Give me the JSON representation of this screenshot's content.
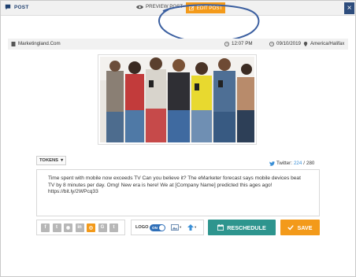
{
  "header": {
    "title": "POST",
    "tabs": [
      {
        "label": "PREVIEW POST",
        "icon": "eye-icon",
        "active": false
      },
      {
        "label": "EDIT POST",
        "icon": "edit-icon",
        "active": true
      }
    ],
    "close_label": "×"
  },
  "info": {
    "account": "Marketingland.Com",
    "time": "12:07 PM",
    "date": "09/10/2019",
    "timezone": "America/Halifax"
  },
  "tokens": {
    "label": "TOKENS",
    "arrow": "▾"
  },
  "twitter": {
    "label": "Twitter:",
    "count": "224",
    "separator": "/",
    "limit": "280"
  },
  "message": "Time spent with mobile now exceeds TV  Can you believe it? The eMarketer forecast says mobile devices beat TV by 8 minutes per day. Omg! New era is here! We at  [Company Name] predicted this ages ago!  https://bit.ly/2WPcq33",
  "social": [
    {
      "label": "f",
      "icon": "facebook-icon",
      "active": false
    },
    {
      "label": "t",
      "icon": "twitter-icon",
      "active": false
    },
    {
      "label": "◉",
      "icon": "reddit-icon",
      "active": false
    },
    {
      "label": "in",
      "icon": "linkedin-icon",
      "active": false
    },
    {
      "label": "◎",
      "icon": "instagram-icon",
      "active": true
    },
    {
      "label": "G",
      "icon": "google-icon",
      "active": false
    },
    {
      "label": "t",
      "icon": "tumblr-icon",
      "active": false
    }
  ],
  "logo": {
    "label": "LOGO",
    "toggle": "ON",
    "toggle_on": true
  },
  "actions": {
    "reschedule": "RESCHEDULE",
    "save": "SAVE"
  },
  "colors": {
    "accent": "#f39a1a",
    "navy": "#2e4d7d",
    "teal": "#2e958e",
    "link": "#3a8fd6"
  }
}
